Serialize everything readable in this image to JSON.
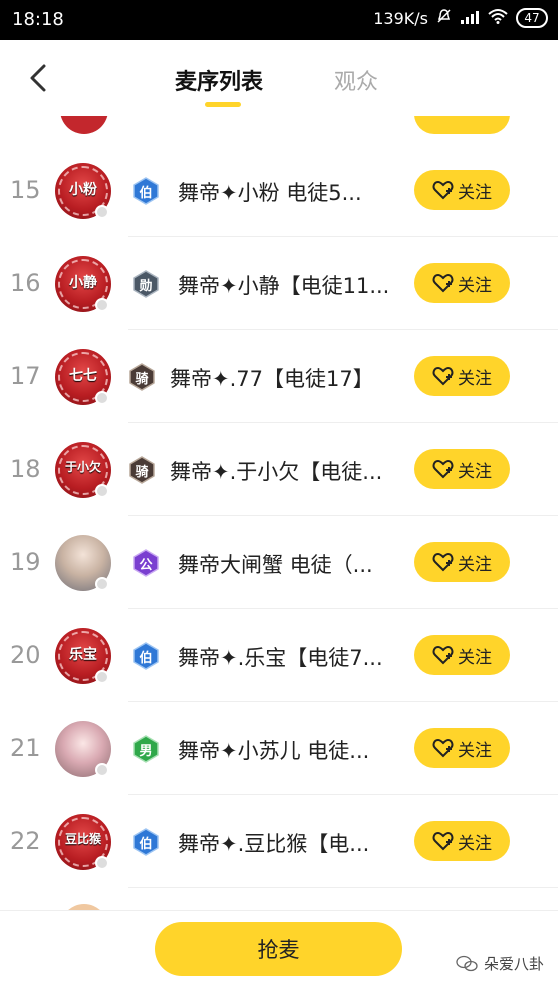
{
  "status_bar": {
    "time": "18:18",
    "net_speed": "139K/s",
    "battery": "47"
  },
  "header": {
    "tab_active": "麦序列表",
    "tab_inactive": "观众"
  },
  "rows": [
    {
      "rank": "15",
      "avatar_text": "小粉",
      "badge": "伯",
      "badge_color": "#2f78d6",
      "name": "舞帝✦小粉  电徒5...",
      "follow": "关注"
    },
    {
      "rank": "16",
      "avatar_text": "小静",
      "badge": "勋",
      "badge_color": "#4b5866",
      "name": "舞帝✦小静【电徒11...",
      "follow": "关注"
    },
    {
      "rank": "17",
      "avatar_text": "七七",
      "badge": "骑",
      "badge_color": "#4a3b36",
      "name": "舞帝✦.77【电徒17】",
      "follow": "关注"
    },
    {
      "rank": "18",
      "avatar_text": "于小欠",
      "badge": "骑",
      "badge_color": "#4a3b36",
      "name": "舞帝✦.于小欠【电徒...",
      "follow": "关注"
    },
    {
      "rank": "19",
      "avatar_text": "",
      "badge": "公",
      "badge_color": "#7a3fd0",
      "name": "舞帝大闸蟹 电徒（...",
      "follow": "关注"
    },
    {
      "rank": "20",
      "avatar_text": "乐宝",
      "badge": "伯",
      "badge_color": "#2f78d6",
      "name": "舞帝✦.乐宝【电徒7...",
      "follow": "关注"
    },
    {
      "rank": "21",
      "avatar_text": "",
      "badge": "男",
      "badge_color": "#2fa84a",
      "name": "舞帝✦小苏儿 电徒...",
      "follow": "关注"
    },
    {
      "rank": "22",
      "avatar_text": "豆比猴",
      "badge": "伯",
      "badge_color": "#2f78d6",
      "name": "舞帝✦.豆比猴【电...",
      "follow": "关注"
    }
  ],
  "bottom": {
    "grab_mic": "抢麦",
    "watermark": "朵爱八卦"
  },
  "colors": {
    "accent": "#ffd42a"
  }
}
